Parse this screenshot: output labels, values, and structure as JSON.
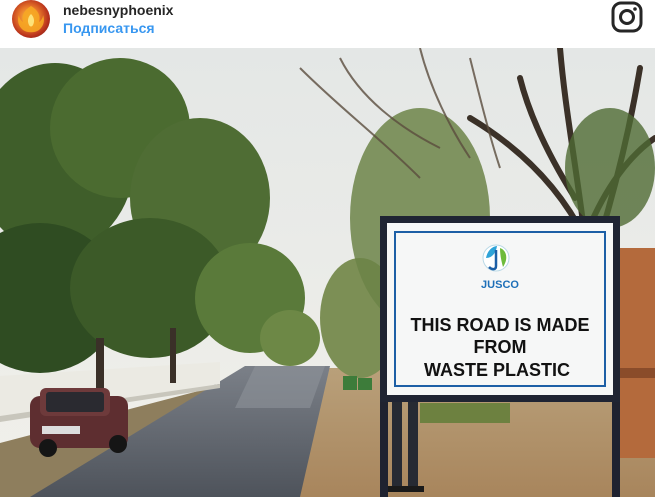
{
  "post": {
    "username": "nebesnyphoenix",
    "follow_label": "Подписаться"
  },
  "photo": {
    "sign": {
      "logo_text": "JUSCO",
      "line1": "THIS ROAD IS MADE",
      "line2": "FROM",
      "line3": "WASTE PLASTIC"
    }
  },
  "colors": {
    "follow": "#3897f0",
    "username": "#262626"
  },
  "icons": {
    "header_right": "instagram-icon"
  }
}
